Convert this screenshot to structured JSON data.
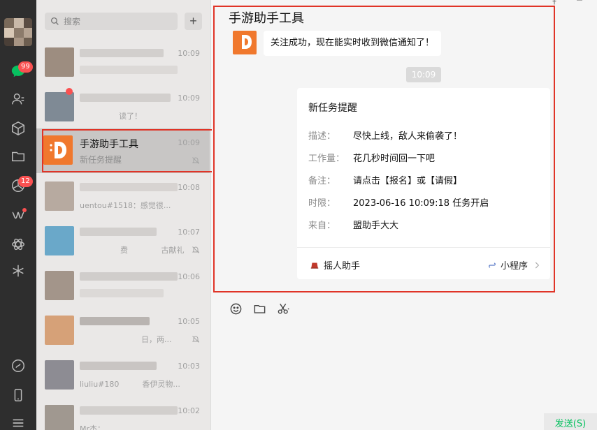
{
  "sidebar": {
    "chat_badge": "99",
    "moments_badge": "12",
    "icons": [
      "chat-icon",
      "contacts-icon",
      "box-icon",
      "folder-icon",
      "moments-icon",
      "channels-icon",
      "miniprogram-icon",
      "search-icon",
      "miniprogram-link-icon",
      "phone-icon",
      "menu-icon"
    ]
  },
  "search": {
    "placeholder": "搜索",
    "add_label": "+"
  },
  "conversations": [
    {
      "time": "10:09"
    },
    {
      "time": "10:09",
      "snippet": "读了！"
    },
    {
      "time": "10:09",
      "name": "手游助手工具",
      "preview": "新任务提醒"
    },
    {
      "time": "10:08",
      "snippet": "uentou#1518：感觉很..."
    },
    {
      "time": "10:07",
      "snippet": "费 　　　　古献礼"
    },
    {
      "time": "10:06"
    },
    {
      "time": "10:05",
      "snippet": "日，两..."
    },
    {
      "time": "10:03",
      "snippet": "liuliu#180　　　香伊灵物..."
    },
    {
      "time": "10:02",
      "snippet": "Mr杰："
    }
  ],
  "chat": {
    "title": "手游助手工具",
    "first_message": "关注成功，现在能实时收到微信通知了！",
    "time_divider": "10:09",
    "card": {
      "title": "新任务提醒",
      "rows": [
        {
          "key": "描述：",
          "value": "尽快上线，敌人来偷袭了！"
        },
        {
          "key": "工作量：",
          "value": "花几秒时间回一下吧"
        },
        {
          "key": "备注：",
          "value": "请点击【报名】或【请假】"
        },
        {
          "key": "时限：",
          "value": "2023-06-16 10:09:18  任务开启"
        },
        {
          "key": "来自：",
          "value": "盟助手大大"
        }
      ],
      "source": "摇人助手",
      "mini_program": "小程序"
    },
    "send_label": "发送(S)"
  },
  "colors": {
    "accent": "#07c160",
    "badge": "#fa5151",
    "brand_orange": "#f0782d",
    "highlight": "#e03427"
  }
}
